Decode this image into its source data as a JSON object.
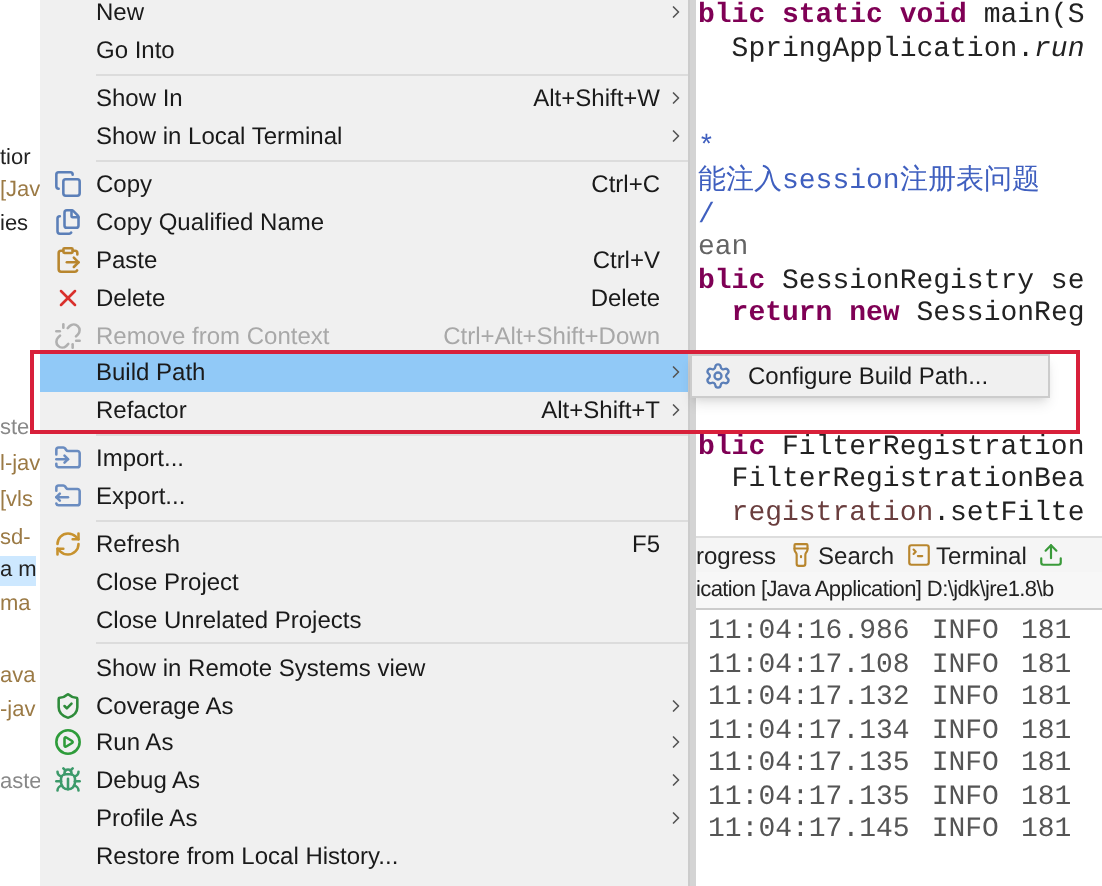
{
  "explorer_fragments": [
    {
      "text": "tior",
      "selected": false
    },
    {
      "text": "[Jav",
      "selected": false
    },
    {
      "text": "ies",
      "selected": false
    },
    {
      "text": "ste",
      "selected": false
    },
    {
      "text": "l-jav",
      "selected": false
    },
    {
      "text": "[vls",
      "selected": false
    },
    {
      "text": "sd-",
      "selected": false
    },
    {
      "text": "a m",
      "selected": true
    },
    {
      "text": "ma",
      "selected": false
    },
    {
      "text": "ava",
      "selected": false
    },
    {
      "text": "-jav",
      "selected": false
    },
    {
      "text": "aste",
      "selected": false
    }
  ],
  "context_menu": [
    {
      "kind": "item",
      "label": "New",
      "submenu": true,
      "disabled": false,
      "selected": false
    },
    {
      "kind": "item",
      "label": "Go Into",
      "submenu": false,
      "disabled": false,
      "selected": false
    },
    {
      "kind": "separator"
    },
    {
      "kind": "item",
      "label": "Show In",
      "shortcut": "Alt+Shift+W",
      "submenu": true,
      "disabled": false,
      "selected": false
    },
    {
      "kind": "item",
      "label": "Show in Local Terminal",
      "submenu": true,
      "disabled": false,
      "selected": false
    },
    {
      "kind": "separator"
    },
    {
      "kind": "item",
      "label": "Copy",
      "shortcut": "Ctrl+C",
      "submenu": false,
      "disabled": false,
      "selected": false
    },
    {
      "kind": "item",
      "label": "Copy Qualified Name",
      "submenu": false,
      "disabled": false,
      "selected": false
    },
    {
      "kind": "item",
      "label": "Paste",
      "shortcut": "Ctrl+V",
      "submenu": false,
      "disabled": false,
      "selected": false
    },
    {
      "kind": "item",
      "label": "Delete",
      "shortcut": "Delete",
      "submenu": false,
      "disabled": false,
      "selected": false
    },
    {
      "kind": "item",
      "label": "Remove from Context",
      "shortcut": "Ctrl+Alt+Shift+Down",
      "submenu": false,
      "disabled": true,
      "selected": false
    },
    {
      "kind": "item",
      "label": "Build Path",
      "submenu": true,
      "disabled": false,
      "selected": true
    },
    {
      "kind": "item",
      "label": "Refactor",
      "shortcut": "Alt+Shift+T",
      "submenu": true,
      "disabled": false,
      "selected": false
    },
    {
      "kind": "separator"
    },
    {
      "kind": "item",
      "label": "Import...",
      "submenu": false,
      "disabled": false,
      "selected": false
    },
    {
      "kind": "item",
      "label": "Export...",
      "submenu": false,
      "disabled": false,
      "selected": false
    },
    {
      "kind": "separator"
    },
    {
      "kind": "item",
      "label": "Refresh",
      "shortcut": "F5",
      "submenu": false,
      "disabled": false,
      "selected": false
    },
    {
      "kind": "item",
      "label": "Close Project",
      "submenu": false,
      "disabled": false,
      "selected": false
    },
    {
      "kind": "item",
      "label": "Close Unrelated Projects",
      "submenu": false,
      "disabled": false,
      "selected": false
    },
    {
      "kind": "separator"
    },
    {
      "kind": "item",
      "label": "Show in Remote Systems view",
      "submenu": false,
      "disabled": false,
      "selected": false
    },
    {
      "kind": "item",
      "label": "Coverage As",
      "submenu": true,
      "disabled": false,
      "selected": false
    },
    {
      "kind": "item",
      "label": "Run As",
      "submenu": true,
      "disabled": false,
      "selected": false
    },
    {
      "kind": "item",
      "label": "Debug As",
      "submenu": true,
      "disabled": false,
      "selected": false
    },
    {
      "kind": "item",
      "label": "Profile As",
      "submenu": true,
      "disabled": false,
      "selected": false
    },
    {
      "kind": "item",
      "label": "Restore from Local History...",
      "submenu": false,
      "disabled": false,
      "selected": false
    }
  ],
  "submenu": {
    "items": [
      {
        "label": "Configure Build Path..."
      }
    ]
  },
  "editor": {
    "lines": [
      {
        "kind": "code",
        "segments": [
          {
            "text": "blic static void",
            "kind": "keyword"
          },
          {
            "text": " main(S",
            "kind": "plain"
          }
        ]
      },
      {
        "kind": "code",
        "segments": [
          {
            "text": "  SpringApplication.",
            "kind": "plain"
          },
          {
            "text": "run",
            "kind": "static"
          }
        ]
      },
      {
        "kind": "blank"
      },
      {
        "kind": "blank"
      },
      {
        "kind": "code",
        "segments": [
          {
            "text": "*",
            "kind": "comment"
          }
        ]
      },
      {
        "kind": "code",
        "segments": [
          {
            "text": "能注入session注册表问题",
            "kind": "comment"
          }
        ]
      },
      {
        "kind": "code",
        "segments": [
          {
            "text": "/",
            "kind": "comment"
          }
        ]
      },
      {
        "kind": "code",
        "segments": [
          {
            "text": "ean",
            "kind": "annotation"
          }
        ]
      },
      {
        "kind": "code",
        "segments": [
          {
            "text": "blic",
            "kind": "keyword"
          },
          {
            "text": " SessionRegistry se",
            "kind": "plain"
          }
        ]
      },
      {
        "kind": "code",
        "segments": [
          {
            "text": "  return new",
            "kind": "keyword"
          },
          {
            "text": " SessionReg",
            "kind": "plain"
          }
        ]
      },
      {
        "kind": "blank"
      },
      {
        "kind": "blank"
      },
      {
        "kind": "blank"
      },
      {
        "kind": "code",
        "segments": [
          {
            "text": "blic",
            "kind": "keyword"
          },
          {
            "text": " FilterRegistration",
            "kind": "plain"
          }
        ]
      },
      {
        "kind": "code",
        "segments": [
          {
            "text": "  FilterRegistrationBea",
            "kind": "plain"
          }
        ]
      },
      {
        "kind": "code",
        "segments": [
          {
            "text": "  registration",
            "kind": "variable"
          },
          {
            "text": ".setFilte",
            "kind": "plain"
          }
        ]
      }
    ]
  },
  "console": {
    "tabs": [
      {
        "label": "rogress"
      },
      {
        "label": "Search"
      },
      {
        "label": "Terminal"
      }
    ],
    "header": "ication [Java Application] D:\\jdk\\jre1.8\\b",
    "rows": [
      {
        "time": "11:04:16.986",
        "level": "INFO",
        "pid": "181"
      },
      {
        "time": "11:04:17.108",
        "level": "INFO",
        "pid": "181"
      },
      {
        "time": "11:04:17.132",
        "level": "INFO",
        "pid": "181"
      },
      {
        "time": "11:04:17.134",
        "level": "INFO",
        "pid": "181"
      },
      {
        "time": "11:04:17.135",
        "level": "INFO",
        "pid": "181"
      },
      {
        "time": "11:04:17.135",
        "level": "INFO",
        "pid": "181"
      },
      {
        "time": "11:04:17.145",
        "level": "INFO",
        "pid": "181"
      }
    ]
  }
}
